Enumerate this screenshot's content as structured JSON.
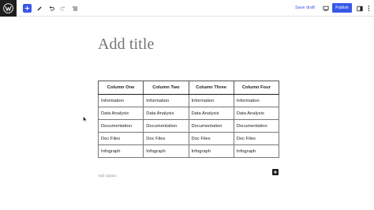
{
  "toolbar": {
    "save_draft": "Save draft",
    "publish": "Publish",
    "accent_color": "#3858e9"
  },
  "editor": {
    "title_placeholder": "Add title",
    "caption_placeholder": "Add caption"
  },
  "table": {
    "headers": [
      "Column One",
      "Column Two",
      "Column Three",
      "Column Four"
    ],
    "rows": [
      [
        "Information",
        "Information",
        "Information",
        "Information"
      ],
      [
        "Data Analysis",
        "Data Analysis",
        "Data Analysis",
        "Data Analysis"
      ],
      [
        "Documentation",
        "Documentation",
        "Documentation",
        "Documentation"
      ],
      [
        "Doc Files",
        "Doc Files",
        "Doc Files",
        "Doc Files"
      ],
      [
        "Infograph",
        "Infograph",
        "Infograph",
        "Infograph"
      ]
    ]
  },
  "icons": [
    "wordpress-logo-icon",
    "plus-icon",
    "pencil-icon",
    "undo-icon",
    "redo-icon",
    "list-view-icon",
    "desktop-preview-icon",
    "settings-sidebar-icon",
    "more-options-icon",
    "block-inserter-icon"
  ]
}
